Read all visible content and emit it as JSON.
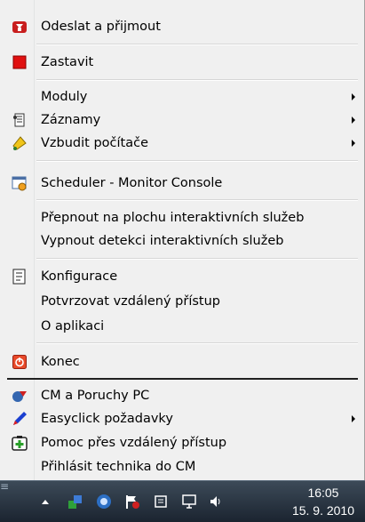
{
  "menu": {
    "send_receive": "Odeslat a přijmout",
    "stop": "Zastavit",
    "modules": "Moduly",
    "records": "Záznamy",
    "wake_computers": "Vzbudit počítače",
    "scheduler": "Scheduler - Monitor Console",
    "switch_desktop": "Přepnout na plochu interaktivních služeb",
    "disable_detection": "Vypnout detekci interaktivních služeb",
    "configuration": "Konfigurace",
    "confirm_remote": "Potvrzovat vzdálený přístup",
    "about": "O aplikaci",
    "exit": "Konec",
    "cm_faults": "CM a Poruchy PC",
    "easyclick": "Easyclick požadavky",
    "remote_help": "Pomoc přes vzdálený přístup",
    "login_technician": "Přihlásit technika do CM"
  },
  "taskbar": {
    "time": "16:05",
    "date": "15. 9. 2010"
  },
  "icons": {
    "send_receive": "send-receive-icon",
    "stop": "stop-icon",
    "records": "records-icon",
    "wake": "wake-bell-icon",
    "scheduler": "scheduler-window-icon",
    "configuration": "configuration-icon",
    "exit": "exit-power-icon",
    "cm": "cm-icon",
    "easyclick": "easyclick-pen-icon",
    "remote_help": "remote-help-icon"
  },
  "colors": {
    "menu_bg": "#f0f0f0",
    "stop_red": "#e01010",
    "exit_red": "#e84a2a",
    "taskbar": "#2a3643"
  }
}
